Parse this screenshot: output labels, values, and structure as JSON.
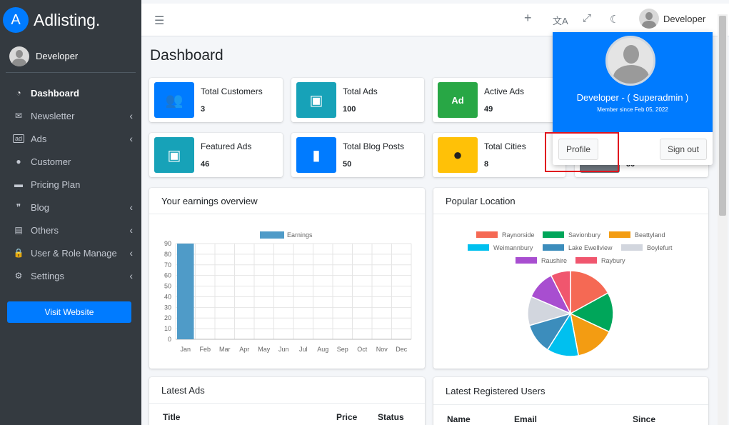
{
  "brand": {
    "logo_letter": "A",
    "name": "Adlisting."
  },
  "sidebar": {
    "user": "Developer",
    "items": [
      {
        "label": "Dashboard",
        "icon": "gauge-icon",
        "glyph": "◔",
        "active": true,
        "chevron": false
      },
      {
        "label": "Newsletter",
        "icon": "envelope-icon",
        "glyph": "✉",
        "chevron": true
      },
      {
        "label": "Ads",
        "icon": "ad-icon",
        "glyph": "ad",
        "chevron": true
      },
      {
        "label": "Customer",
        "icon": "user-icon",
        "glyph": "●",
        "chevron": false
      },
      {
        "label": "Pricing Plan",
        "icon": "credit-card-icon",
        "glyph": "▬",
        "chevron": false
      },
      {
        "label": "Blog",
        "icon": "blog-icon",
        "glyph": "❞",
        "chevron": true
      },
      {
        "label": "Others",
        "icon": "list-icon",
        "glyph": "▤",
        "chevron": true
      },
      {
        "label": "User & Role Manage",
        "icon": "lock-icon",
        "glyph": "🔒",
        "chevron": true
      },
      {
        "label": "Settings",
        "icon": "gear-icon",
        "glyph": "⚙",
        "chevron": true
      }
    ],
    "visit_label": "Visit Website"
  },
  "topnav": {
    "user": "Developer"
  },
  "page_title": "Dashboard",
  "info_boxes": [
    {
      "label": "Total Customers",
      "value": "3",
      "color": "#007bff"
    },
    {
      "label": "Total Ads",
      "value": "100",
      "color": "#17a2b8"
    },
    {
      "label": "Active Ads",
      "value": "49",
      "color": "#28a745"
    },
    {
      "label": "Featured Ads",
      "value": "46",
      "color": "#17a2b8"
    },
    {
      "label": "Total Blog Posts",
      "value": "50",
      "color": "#007bff"
    },
    {
      "label": "Total Cities",
      "value": "8",
      "color": "#ffc107"
    },
    {
      "label": "",
      "value": "50",
      "color": "#6c757d"
    }
  ],
  "cards": {
    "earnings": "Your earnings overview",
    "location": "Popular Location",
    "latest_ads": "Latest Ads",
    "latest_users": "Latest Registered Users"
  },
  "latest_ads_table": {
    "headers": [
      "Title",
      "Price",
      "Status"
    ]
  },
  "latest_users_table": {
    "headers": [
      "Name",
      "Email",
      "Since"
    ]
  },
  "dropdown": {
    "name": "Developer - ( Superadmin )",
    "since": "Member since Feb 05, 2022",
    "profile_label": "Profile",
    "signout_label": "Sign out",
    "header_color": "#007bff"
  },
  "chart_data": [
    {
      "type": "bar",
      "legend": [
        "Earnings"
      ],
      "categories": [
        "Jan",
        "Feb",
        "Mar",
        "Apr",
        "May",
        "Jun",
        "Jul",
        "Aug",
        "Sep",
        "Oct",
        "Nov",
        "Dec"
      ],
      "series": [
        {
          "name": "Earnings",
          "values": [
            90,
            0,
            0,
            0,
            0,
            0,
            0,
            0,
            0,
            0,
            0,
            0
          ],
          "color": "#4f9bc8"
        }
      ],
      "yticks": [
        "0",
        "10",
        "20",
        "30",
        "40",
        "50",
        "60",
        "70",
        "80",
        "90"
      ],
      "ylim": [
        0,
        90
      ],
      "grid": true,
      "legend_position": "top"
    },
    {
      "type": "pie",
      "slices": [
        {
          "label": "Raynorside",
          "value": 17,
          "color": "#f56954"
        },
        {
          "label": "Savionbury",
          "value": 15,
          "color": "#00a65a"
        },
        {
          "label": "Beattyland",
          "value": 15,
          "color": "#f39c12"
        },
        {
          "label": "Weimannbury",
          "value": 12,
          "color": "#00c0ef"
        },
        {
          "label": "Lake Ewellview",
          "value": 11.5,
          "color": "#3c8dbc"
        },
        {
          "label": "Boylefurt",
          "value": 11,
          "color": "#d2d6de"
        },
        {
          "label": "Raushire",
          "value": 11,
          "color": "#a84ed0"
        },
        {
          "label": "Raybury",
          "value": 7.5,
          "color": "#f0566e"
        }
      ],
      "legend_position": "top"
    }
  ]
}
